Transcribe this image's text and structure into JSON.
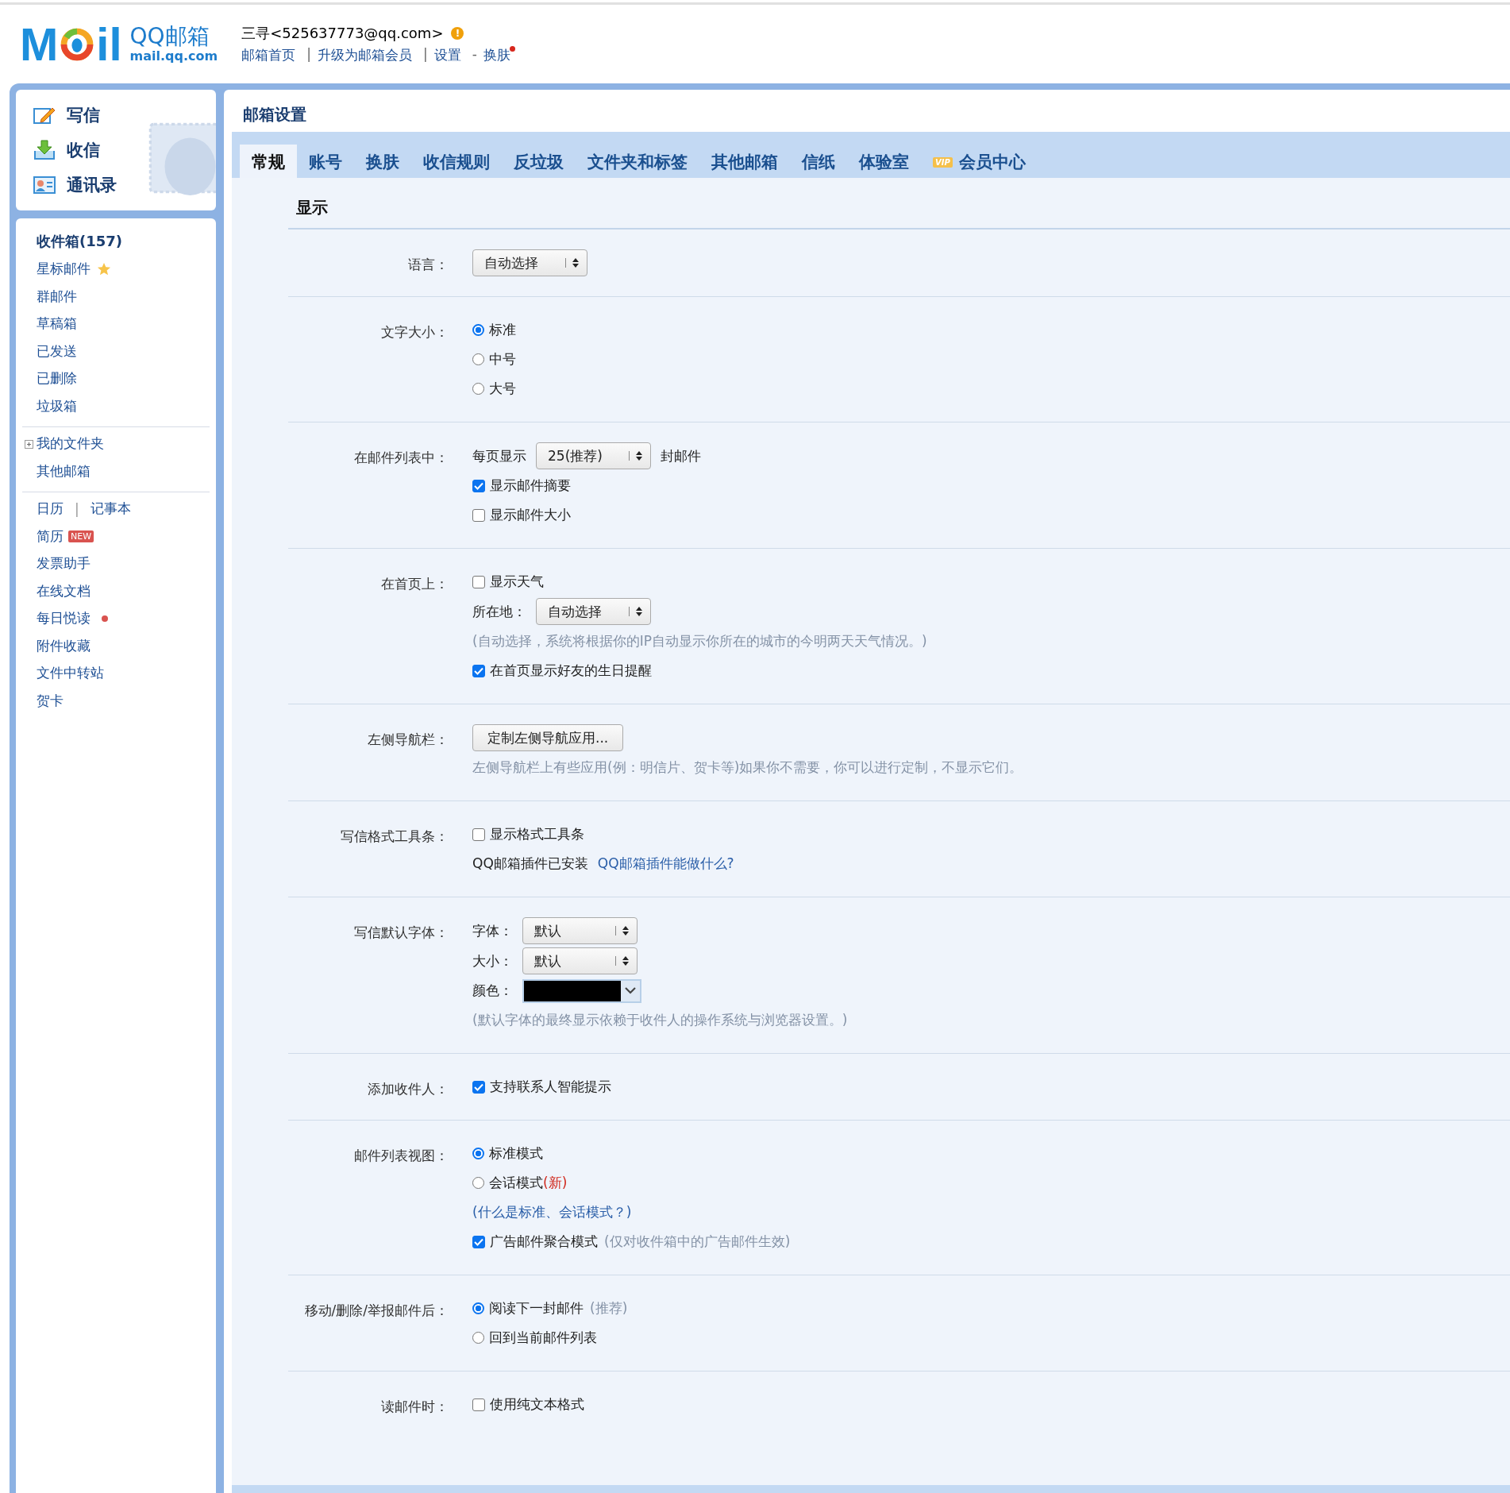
{
  "header": {
    "logo": {
      "left": "M",
      "right": "il",
      "name": "QQ邮箱",
      "domain": "mail.qq.com"
    },
    "account": "三寻<525637773@qq.com>",
    "alert": "!",
    "links": [
      {
        "text": "邮箱首页"
      },
      {
        "sep": "|",
        "text": "升级为邮箱会员"
      },
      {
        "sep": "|",
        "text": "设置"
      },
      {
        "sep": "-",
        "text": "换肤",
        "notice": true
      }
    ]
  },
  "quick_actions": [
    {
      "label": "写信",
      "kind": "compose"
    },
    {
      "label": "收信",
      "kind": "receive"
    },
    {
      "label": "通讯录",
      "kind": "contacts"
    }
  ],
  "sidebar": {
    "groups": [
      [
        {
          "label": "收件箱(157)",
          "kind": "inbox"
        },
        {
          "label": "星标邮件",
          "kind": "star"
        },
        {
          "label": "群邮件"
        },
        {
          "label": "草稿箱"
        },
        {
          "label": "已发送"
        },
        {
          "label": "已删除"
        },
        {
          "label": "垃圾箱"
        }
      ],
      [
        {
          "label": "我的文件夹",
          "kind": "tree",
          "expanded": false
        },
        {
          "label": "其他邮箱"
        }
      ],
      [
        {
          "kind": "pair",
          "labels": [
            "日历",
            "记事本"
          ],
          "sep": "|"
        },
        {
          "label": "简历",
          "badge": "NEW"
        },
        {
          "label": "发票助手"
        },
        {
          "label": "在线文档"
        },
        {
          "label": "每日悦读",
          "kind": "dot"
        },
        {
          "label": "附件收藏"
        },
        {
          "label": "文件中转站"
        },
        {
          "label": "贺卡"
        }
      ]
    ]
  },
  "page_title": "邮箱设置",
  "tabs": [
    {
      "label": "常规",
      "selected": true
    },
    {
      "label": "账号",
      "selected": false
    },
    {
      "label": "换肤",
      "selected": false
    },
    {
      "label": "收信规则",
      "selected": false
    },
    {
      "label": "反垃圾",
      "selected": false
    },
    {
      "label": "文件夹和标签",
      "selected": false
    },
    {
      "label": "其他邮箱",
      "selected": false
    },
    {
      "label": "信纸",
      "selected": false
    },
    {
      "label": "体验室",
      "selected": false
    },
    {
      "label": "会员中心",
      "selected": false,
      "vip": "VIP"
    }
  ],
  "section_title": "显示",
  "rows": [
    {
      "label": "语言：",
      "lines": [
        [
          {
            "kind": "select",
            "value": "自动选择"
          }
        ]
      ]
    },
    {
      "label": "文字大小：",
      "lines": [
        [
          {
            "kind": "radio",
            "label": "标准",
            "selected": true
          }
        ],
        [
          {
            "kind": "radio",
            "label": "中号",
            "selected": false
          }
        ],
        [
          {
            "kind": "radio",
            "label": "大号",
            "selected": false
          }
        ]
      ]
    },
    {
      "label": "在邮件列表中：",
      "lines": [
        [
          {
            "kind": "text",
            "text": "每页显示"
          },
          {
            "kind": "select",
            "value": "25(推荐)"
          },
          {
            "kind": "text",
            "text": "封邮件"
          }
        ],
        [
          {
            "kind": "checkbox",
            "label": "显示邮件摘要",
            "checked": true
          }
        ],
        [
          {
            "kind": "checkbox",
            "label": "显示邮件大小",
            "checked": false
          }
        ]
      ]
    },
    {
      "label": "在首页上：",
      "lines": [
        [
          {
            "kind": "checkbox",
            "label": "显示天气",
            "checked": false
          }
        ],
        [
          {
            "kind": "text",
            "text": "所在地："
          },
          {
            "kind": "select",
            "value": "自动选择"
          }
        ],
        [
          {
            "kind": "note",
            "text": "(自动选择，系统将根据你的IP自动显示你所在的城市的今明两天天气情况。)"
          }
        ],
        [
          {
            "kind": "checkbox",
            "label": "在首页显示好友的生日提醒",
            "checked": true
          }
        ]
      ]
    },
    {
      "label": "左侧导航栏：",
      "lines": [
        [
          {
            "kind": "button",
            "label": "定制左侧导航应用..."
          }
        ],
        [
          {
            "kind": "note",
            "text": "左侧导航栏上有些应用(例：明信片、贺卡等)如果你不需要，你可以进行定制，不显示它们。"
          }
        ]
      ]
    },
    {
      "label": "写信格式工具条：",
      "lines": [
        [
          {
            "kind": "checkbox",
            "label": "显示格式工具条",
            "checked": false
          }
        ],
        [
          {
            "kind": "text",
            "text": "QQ邮箱插件已安装"
          },
          {
            "kind": "link",
            "text": "QQ邮箱插件能做什么?"
          }
        ]
      ]
    },
    {
      "label": "写信默认字体：",
      "lines": [
        [
          {
            "kind": "text",
            "text": "字体："
          },
          {
            "kind": "select",
            "value": "默认"
          }
        ],
        [
          {
            "kind": "text",
            "text": "大小："
          },
          {
            "kind": "select",
            "value": "默认"
          }
        ],
        [
          {
            "kind": "text",
            "text": "颜色："
          },
          {
            "kind": "color",
            "color": "#000000"
          }
        ],
        [
          {
            "kind": "note",
            "text": "(默认字体的最终显示依赖于收件人的操作系统与浏览器设置。)"
          }
        ]
      ]
    },
    {
      "label": "添加收件人：",
      "lines": [
        [
          {
            "kind": "checkbox",
            "label": "支持联系人智能提示",
            "checked": true
          }
        ]
      ]
    },
    {
      "label": "邮件列表视图：",
      "lines": [
        [
          {
            "kind": "radio",
            "label": "标准模式",
            "selected": true
          }
        ],
        [
          {
            "kind": "radio",
            "label": "会话模式",
            "tag": "(新)",
            "selected": false
          }
        ],
        [
          {
            "kind": "link",
            "text": "(什么是标准、会话模式？)"
          }
        ],
        [
          {
            "kind": "checkbox",
            "label": "广告邮件聚合模式",
            "note": "(仅对收件箱中的广告邮件生效)",
            "checked": true
          }
        ]
      ]
    },
    {
      "label": "移动/删除/举报邮件后：",
      "lines": [
        [
          {
            "kind": "radio",
            "label": "阅读下一封邮件",
            "note": "(推荐)",
            "selected": true
          }
        ],
        [
          {
            "kind": "radio",
            "label": "回到当前邮件列表",
            "selected": false
          }
        ]
      ]
    },
    {
      "label": "读邮件时：",
      "lines": [
        [
          {
            "kind": "checkbox",
            "label": "使用纯文本格式",
            "checked": false
          }
        ]
      ]
    }
  ]
}
